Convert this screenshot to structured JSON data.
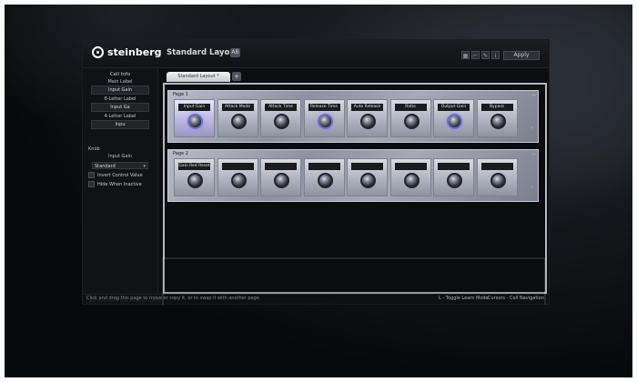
{
  "app": {
    "brand": "steinberg",
    "layout_title": "Standard Layout",
    "layout_button": "AB",
    "apply": "Apply",
    "toolbar_icons": [
      "grid-icon",
      "crop-icon",
      "script-icon",
      "info-icon"
    ]
  },
  "sidebar": {
    "cell_info_title": "Cell Info",
    "main_label_title": "Main Label",
    "main_label_value": "Input Gain",
    "label8_title": "8-Letter Label",
    "label8_value": "Input Ga",
    "label4_title": "4-Letter Label",
    "label4_value": "Inpu",
    "knob_title": "Knob",
    "knob_value": "Input Gain",
    "dropdown_value": "Standard",
    "invert_label": "Invert Control Value",
    "hide_label": "Hide When Inactive"
  },
  "tabs": {
    "active_label": "Standard Layout *",
    "add_label": "+"
  },
  "pages": [
    {
      "title": "Page 1",
      "cells": [
        "Input Gain",
        "Attack Mode",
        "Attack Time",
        "Release Time",
        "Auto Release",
        "Ratio",
        "Output Gain",
        "Bypass"
      ]
    },
    {
      "title": "Page 2",
      "cells": [
        "Gain Red Reset",
        "",
        "",
        "",
        "",
        "",
        "",
        ""
      ]
    }
  ],
  "status": {
    "hint": "Click and drag this page to move or copy it, or to swap it with another page.",
    "learn": "L - Toggle Learn Mode",
    "nav": "Cursors - Cell Navigation"
  }
}
